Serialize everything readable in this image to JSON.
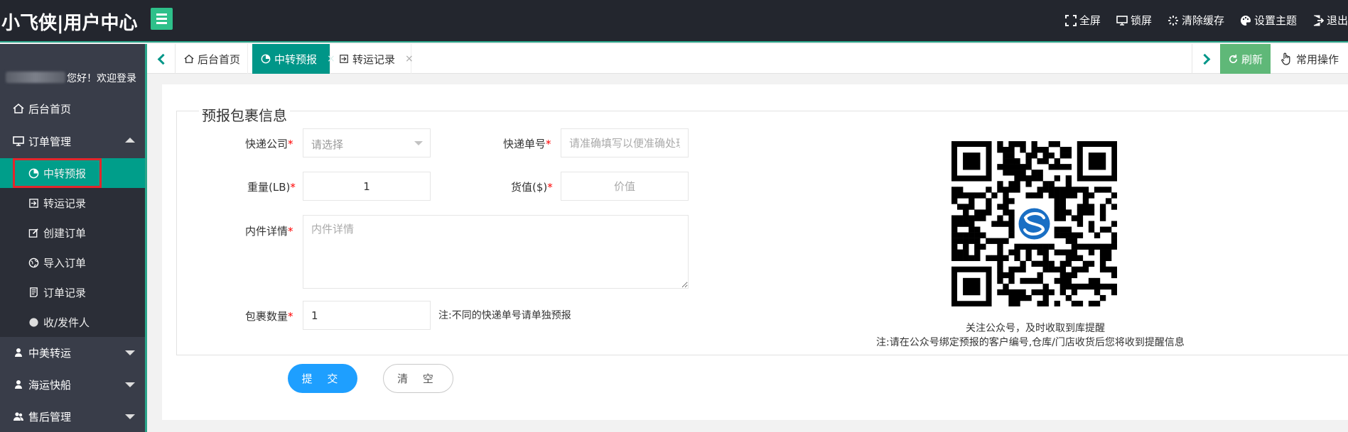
{
  "header": {
    "brand": "小飞侠|用户中心",
    "actions": [
      {
        "label": "全屏",
        "icon": "fullscreen-icon"
      },
      {
        "label": "锁屏",
        "icon": "monitor-icon"
      },
      {
        "label": "清除缓存",
        "icon": "spinner-icon"
      },
      {
        "label": "设置主题",
        "icon": "palette-icon"
      },
      {
        "label": "退出",
        "icon": "logout-icon"
      }
    ]
  },
  "sidebar": {
    "welcome": "您好！欢迎登录",
    "home": "后台首页",
    "order_mgmt": "订单管理",
    "sub_items": [
      "中转预报",
      "转运记录",
      "创建订单",
      "导入订单",
      "订单记录",
      "收/发件人"
    ],
    "cn_us": "中美转运",
    "sea": "海运快船",
    "aftersale": "售后管理"
  },
  "tabs": {
    "items": [
      {
        "label": "后台首页",
        "closable": false
      },
      {
        "label": "中转预报",
        "closable": true,
        "active": true
      },
      {
        "label": "转运记录",
        "closable": true
      }
    ],
    "close_glyph": "×",
    "refresh": "刷新",
    "common_ops": "常用操作"
  },
  "form": {
    "legend": "预报包裹信息",
    "required_mark": "*",
    "courier_label": "快递公司",
    "courier_placeholder": "请选择",
    "tracking_label": "快递单号",
    "tracking_placeholder": "请准确填写以便准确处理",
    "weight_label": "重量(LB)",
    "weight_value": "1",
    "value_label": "货值($)",
    "value_placeholder": "价值",
    "contents_label": "内件详情",
    "contents_placeholder": "内件详情",
    "count_label": "包裹数量",
    "count_value": "1",
    "count_note": "注:不同的快递单号请单独预报",
    "qr_caption1": "关注公众号，及时收取到库提醒",
    "qr_caption2": "注:请在公众号绑定预报的客户编号,仓库/门店收货后您将收到提醒信息",
    "submit": "提 交",
    "clear": "清 空"
  },
  "colors": {
    "topbar": "#23262e",
    "sidebar": "#393d49",
    "accent": "#009688",
    "refresh": "#5fb878",
    "primary_button": "#1e9fff",
    "highlight_box": "#e3262b"
  }
}
